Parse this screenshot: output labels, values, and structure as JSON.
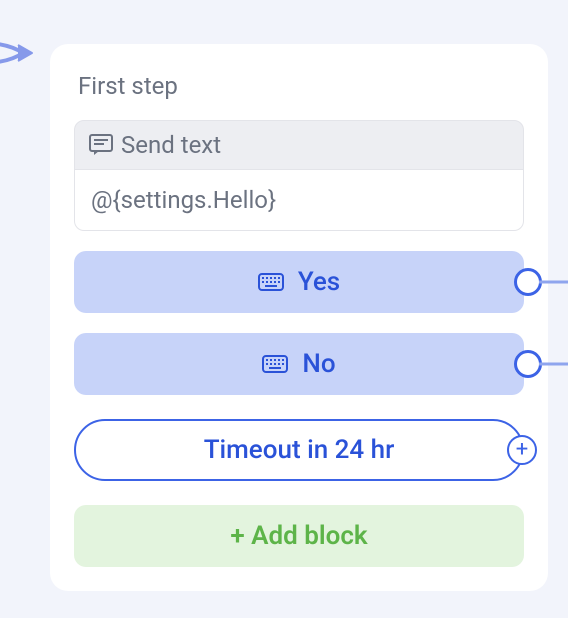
{
  "card": {
    "title": "First step",
    "send_text": {
      "header_label": "Send text",
      "body": "@{settings.Hello}"
    },
    "replies": [
      {
        "label": "Yes"
      },
      {
        "label": "No"
      }
    ],
    "timeout": {
      "label": "Timeout in 24 hr"
    },
    "add_block": {
      "label": "+ Add block"
    }
  }
}
